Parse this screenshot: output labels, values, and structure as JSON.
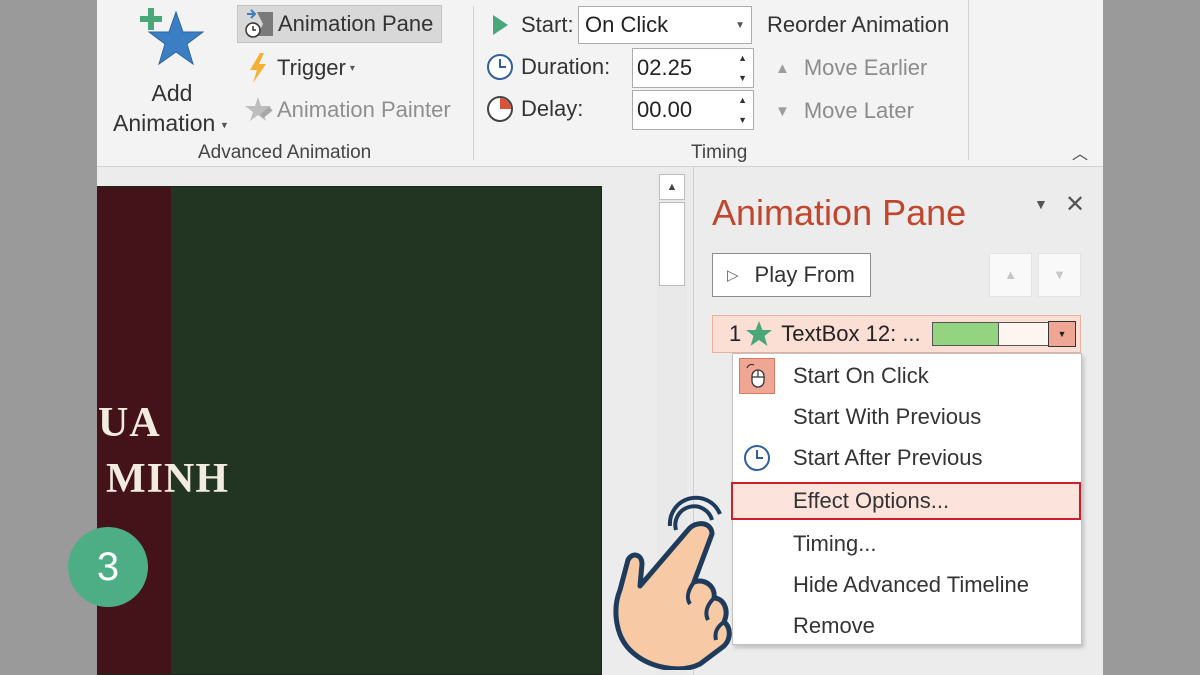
{
  "ribbon": {
    "add_animation": {
      "line1": "Add",
      "line2": "Animation"
    },
    "animation_pane_btn": "Animation Pane",
    "trigger_btn": "Trigger",
    "animation_painter_btn": "Animation Painter",
    "advanced_group_label": "Advanced Animation",
    "timing": {
      "start_label": "Start:",
      "start_value": "On Click",
      "duration_label": "Duration:",
      "duration_value": "02.25",
      "delay_label": "Delay:",
      "delay_value": "00.00",
      "group_label": "Timing"
    },
    "reorder": {
      "title": "Reorder Animation",
      "move_earlier": "Move Earlier",
      "move_later": "Move Later"
    }
  },
  "slide": {
    "text_line1": "UA",
    "text_line2": "MINH"
  },
  "animation_pane": {
    "title": "Animation Pane",
    "play_from": "Play From",
    "item": {
      "number": "1",
      "label": "TextBox 12: ...",
      "timeline_progress": 0.57
    }
  },
  "context_menu": {
    "items": [
      {
        "label": "Start On Click",
        "icon": "mouse-click-icon",
        "selected_icon": true
      },
      {
        "label": "Start With Previous",
        "icon": ""
      },
      {
        "label": "Start After Previous",
        "icon": "clock-icon"
      },
      {
        "label": "Effect Options...",
        "icon": "",
        "highlighted": true
      },
      {
        "label": "Timing...",
        "icon": ""
      },
      {
        "label": "Hide Advanced Timeline",
        "icon": ""
      },
      {
        "label": "Remove",
        "icon": ""
      }
    ]
  },
  "step_badge": "3",
  "colors": {
    "pane_title": "#c0462d",
    "highlight_border": "#cc1f27",
    "badge": "#4dae86",
    "timeline_fill": "#94d37f",
    "slide_bg": "#223422",
    "slide_stripe": "#441319"
  }
}
